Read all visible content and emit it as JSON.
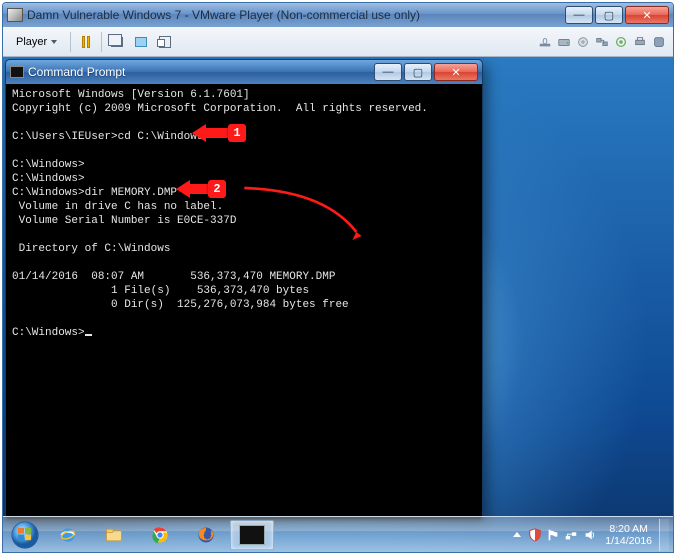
{
  "vmware": {
    "title_main": "Damn Vulnerable Windows 7 - VMware Player (Non-commercial use only)",
    "player_label": "Player",
    "tray_icons": [
      "send-ctrl-alt-del",
      "printer",
      "drive",
      "network",
      "sound",
      "cd"
    ]
  },
  "cmd": {
    "title": "Command Prompt",
    "lines": [
      "Microsoft Windows [Version 6.1.7601]",
      "Copyright (c) 2009 Microsoft Corporation.  All rights reserved.",
      "",
      "C:\\Users\\IEUser>cd C:\\Windows",
      "",
      "C:\\Windows>",
      "C:\\Windows>",
      "C:\\Windows>dir MEMORY.DMP",
      " Volume in drive C has no label.",
      " Volume Serial Number is E0CE-337D",
      "",
      " Directory of C:\\Windows",
      "",
      "01/14/2016  08:07 AM       536,373,470 MEMORY.DMP",
      "               1 File(s)    536,373,470 bytes",
      "               0 Dir(s)  125,276,073,984 bytes free",
      "",
      "C:\\Windows>"
    ]
  },
  "annotations": {
    "badge1": "1",
    "badge2": "2"
  },
  "taskbar": {
    "time": "8:20 AM",
    "date": "1/14/2016"
  }
}
